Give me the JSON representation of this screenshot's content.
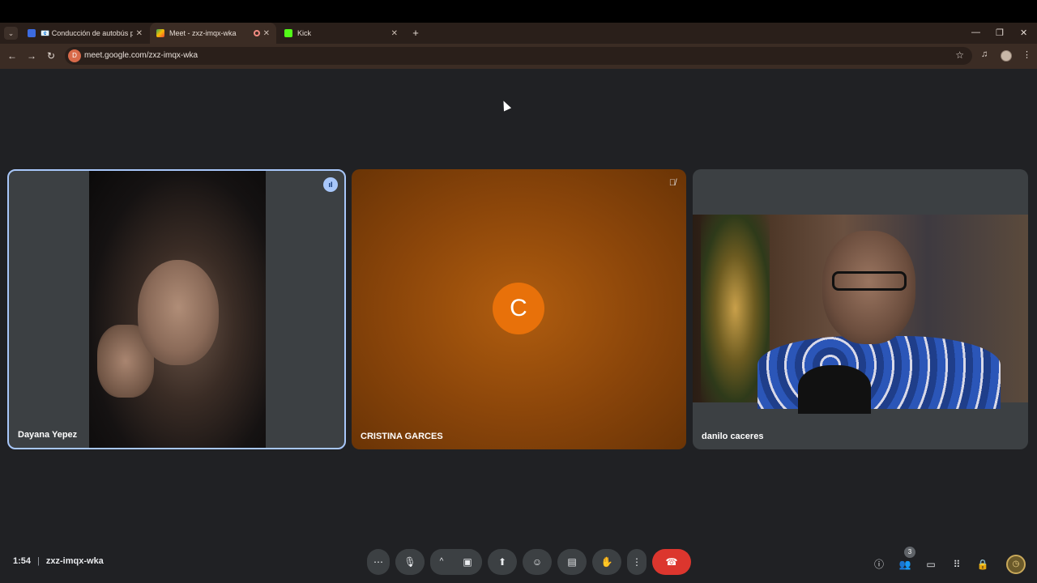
{
  "browser": {
    "tabs": [
      {
        "title": "📧 Conducción de autobús peligrosa",
        "active": false
      },
      {
        "title": "Meet - zxz-imqx-wka",
        "active": true
      },
      {
        "title": "Kick",
        "active": false
      }
    ],
    "url": "meet.google.com/zxz-imqx-wka",
    "site_icon_label": "D"
  },
  "meet": {
    "participants": [
      {
        "name": "Dayana Yepez",
        "state": "speaking"
      },
      {
        "name": "CRISTINA GARCES",
        "avatar_letter": "C",
        "state": "muted"
      },
      {
        "name": "danilo caceres",
        "state": "video"
      }
    ],
    "time": "1:54",
    "meeting_code": "zxz-imqx-wka",
    "participant_count": "3"
  },
  "colors": {
    "speaking_border": "#a8c7fa",
    "avatar_orange": "#e8710a",
    "end_call_red": "#dc362e"
  }
}
